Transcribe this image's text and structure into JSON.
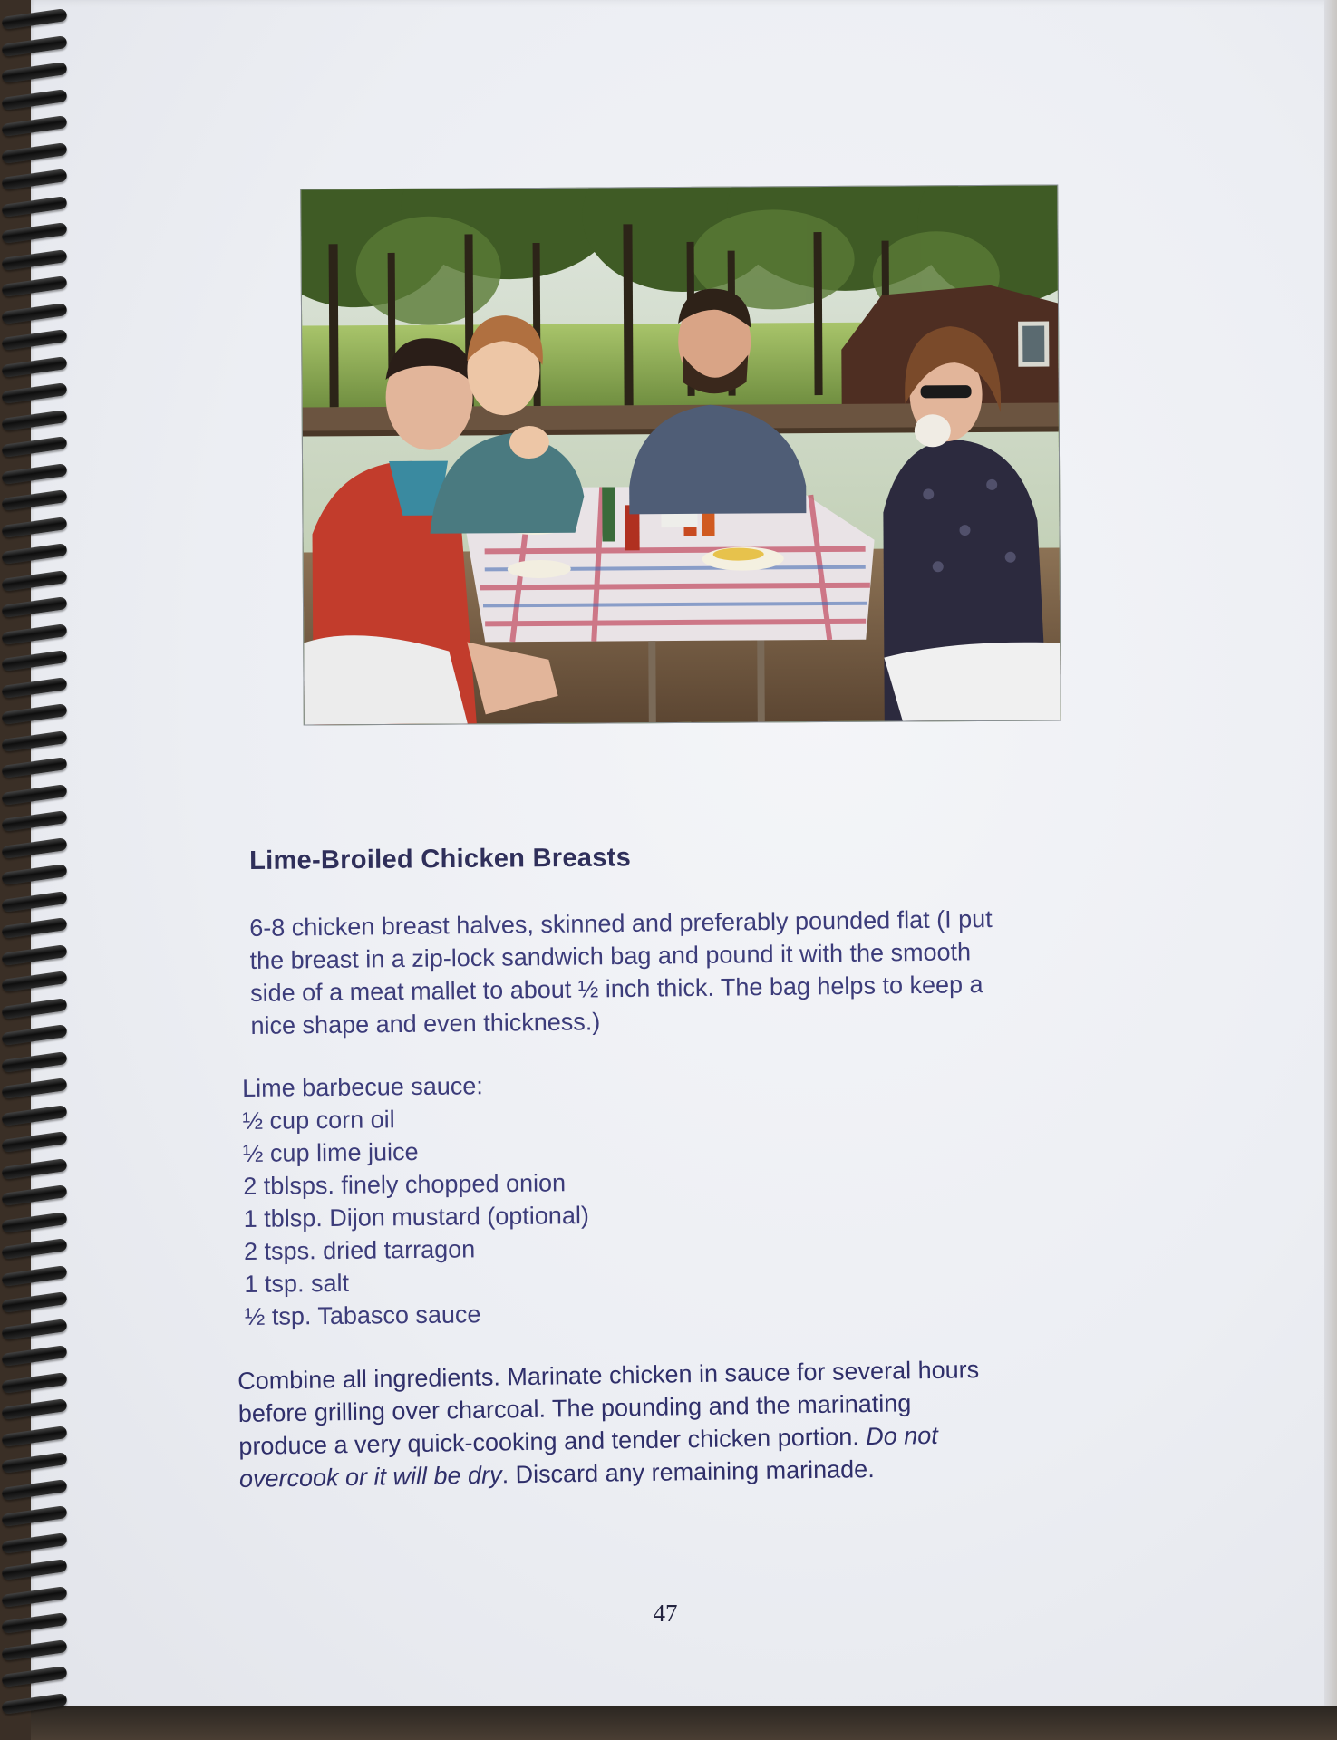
{
  "recipe": {
    "title": "Lime-Broiled Chicken Breasts",
    "intro_lines": [
      "6-8 chicken breast halves, skinned and preferably pounded flat (I put",
      "the breast in a zip-lock sandwich bag and pound it with the smooth",
      "side of a meat mallet to about ½ inch thick. The bag helps to keep a",
      "nice shape and even thickness.)"
    ],
    "sauce_heading": "Lime barbecue sauce:",
    "ingredients": [
      "½ cup corn oil",
      "½ cup lime juice",
      "2 tblsps. finely chopped onion",
      "1 tblsp. Dijon mustard (optional)",
      "2 tsps. dried tarragon",
      "1 tsp. salt",
      "½ tsp. Tabasco sauce"
    ],
    "directions": {
      "line1": "Combine all ingredients. Marinate chicken in sauce for several hours",
      "line2": "before grilling over charcoal. The pounding and the marinating",
      "line3_plain": "produce a very quick-cooking and tender chicken portion. ",
      "line3_italic": "Do not",
      "line4_italic": "overcook or it will be dry",
      "line4_plain": ". Discard any remaining marinade."
    }
  },
  "page_number": "47",
  "colors": {
    "ink": "#3c3c7a",
    "title": "#2f2f5a",
    "paper": "#eceef3"
  }
}
